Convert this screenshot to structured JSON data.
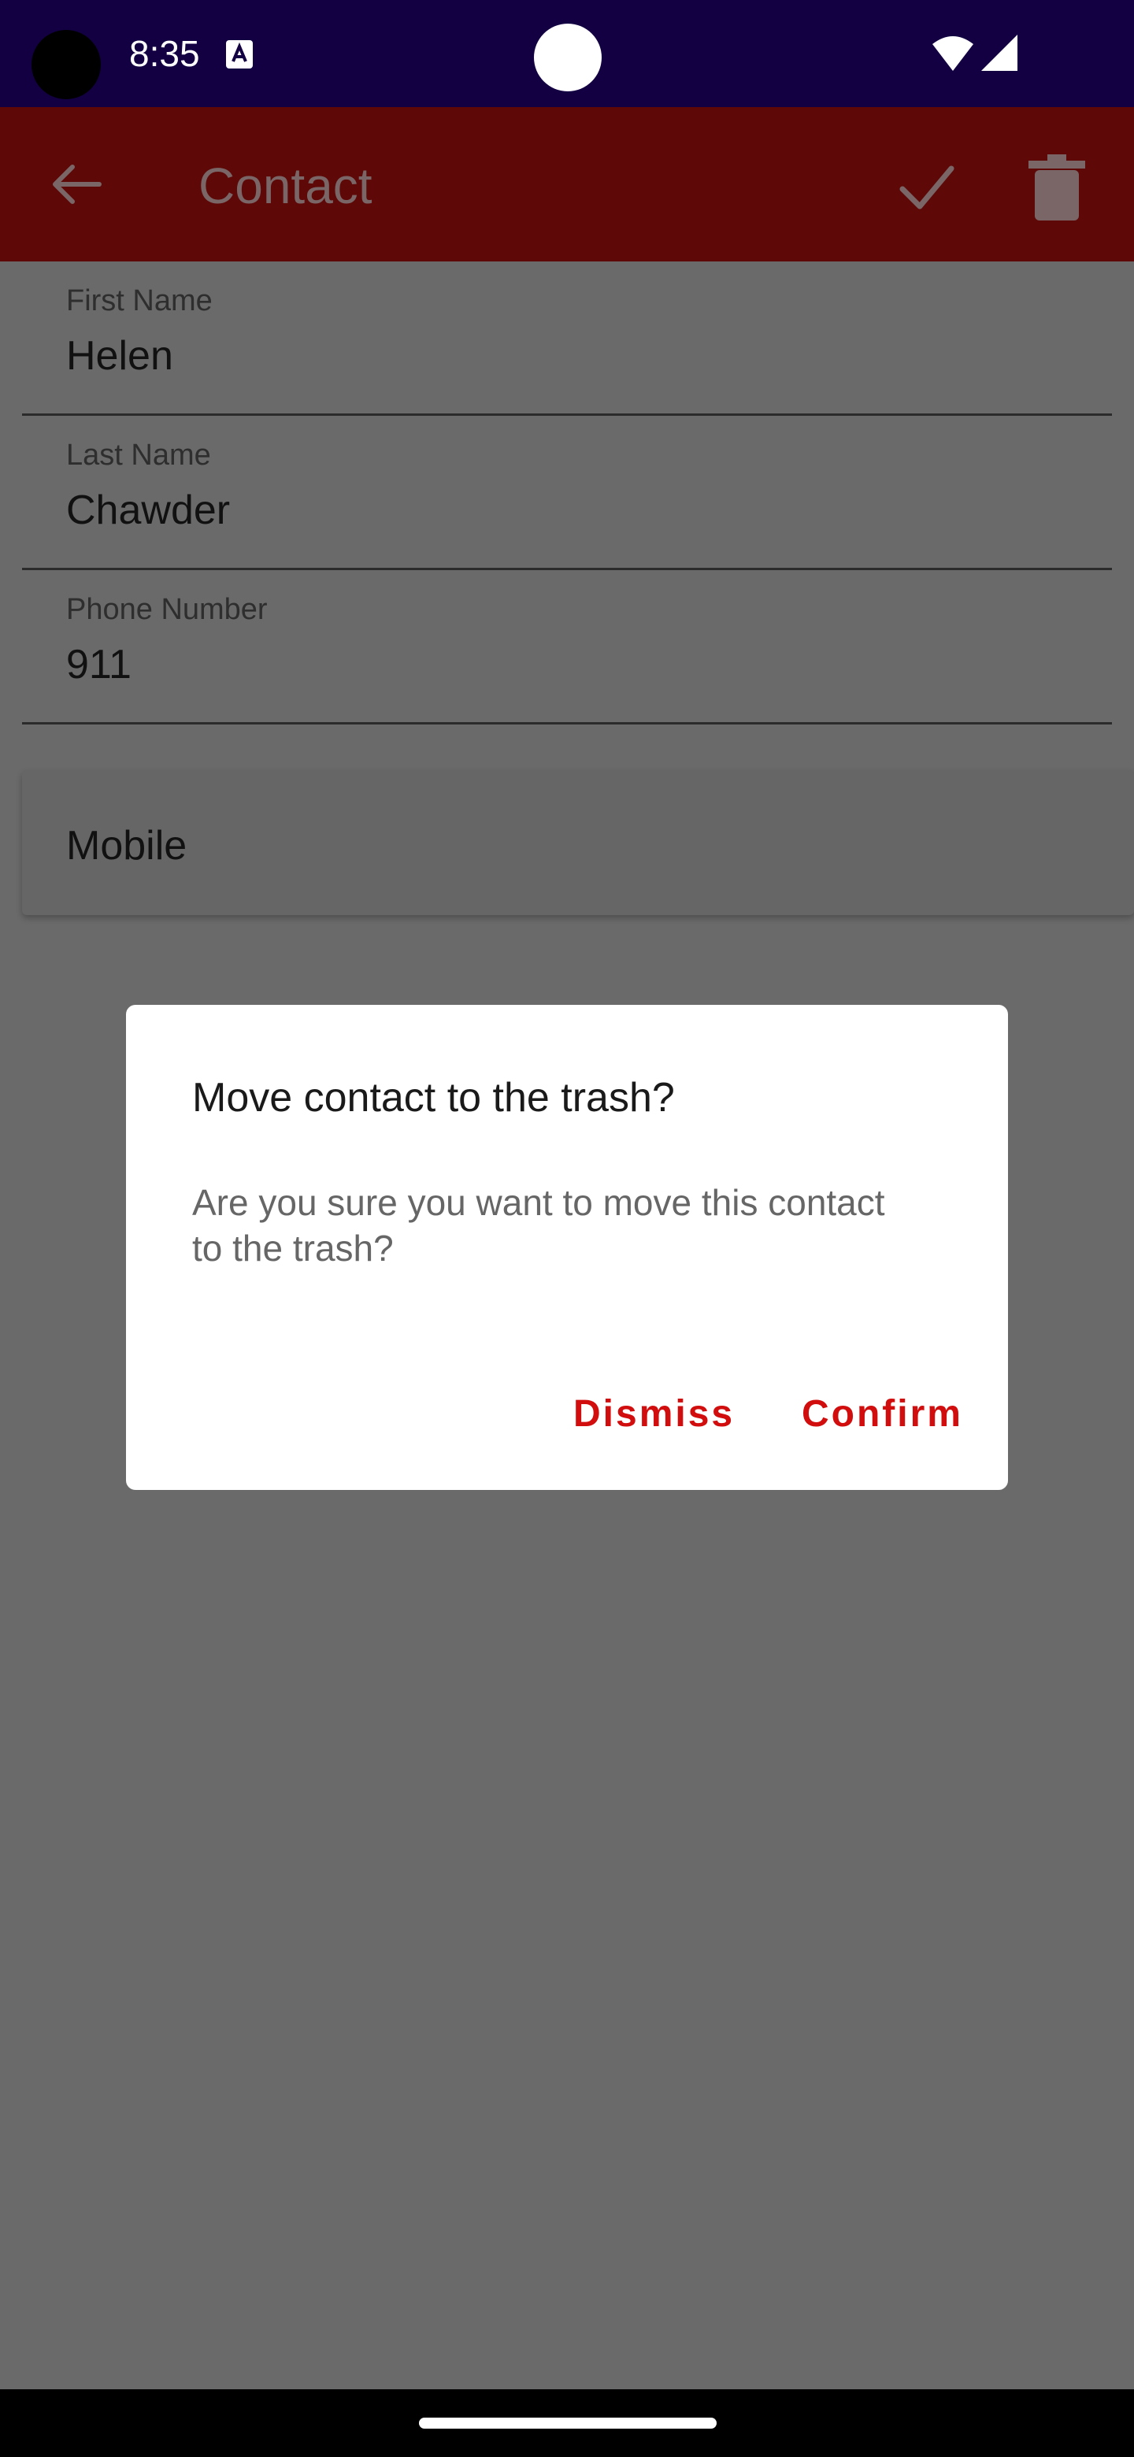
{
  "status_bar": {
    "time": "8:35",
    "icons": [
      "a-icon",
      "wifi-icon",
      "signal-icon"
    ]
  },
  "app_bar": {
    "title": "Contact",
    "actions": [
      "back-arrow-icon",
      "check-icon",
      "trash-icon"
    ],
    "background_color": "#5e0808"
  },
  "form": {
    "first_name": {
      "label": "First Name",
      "value": "Helen"
    },
    "last_name": {
      "label": "Last Name",
      "value": "Chawder"
    },
    "phone_number": {
      "label": "Phone Number",
      "value": "911"
    },
    "phone_type": {
      "value": "Mobile"
    }
  },
  "dialog": {
    "title": "Move contact to the trash?",
    "message": "Are you sure you want to move this contact to the trash?",
    "dismiss_label": "Dismiss",
    "confirm_label": "Confirm",
    "accent_color": "#d10d0d"
  }
}
